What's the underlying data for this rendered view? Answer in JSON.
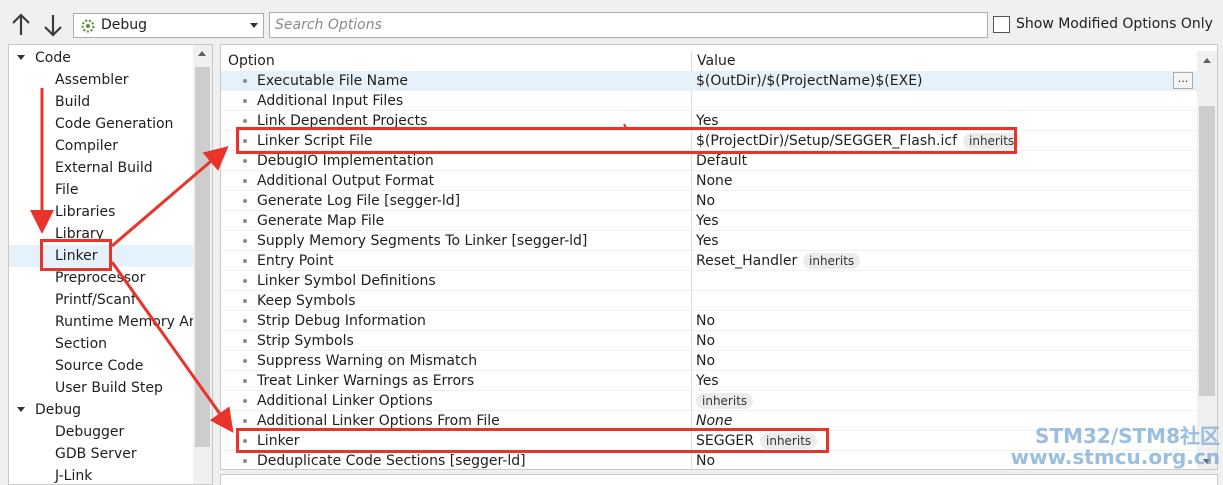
{
  "toolbar": {
    "config": "Debug",
    "search_placeholder": "Search Options",
    "show_modified_label": "Show Modified Options Only"
  },
  "tree": {
    "items": [
      {
        "label": "Code",
        "group": true
      },
      {
        "label": "Assembler"
      },
      {
        "label": "Build"
      },
      {
        "label": "Code Generation"
      },
      {
        "label": "Compiler"
      },
      {
        "label": "External Build"
      },
      {
        "label": "File"
      },
      {
        "label": "Libraries"
      },
      {
        "label": "Library"
      },
      {
        "label": "Linker",
        "selected": true
      },
      {
        "label": "Preprocessor"
      },
      {
        "label": "Printf/Scanf"
      },
      {
        "label": "Runtime Memory Ar"
      },
      {
        "label": "Section"
      },
      {
        "label": "Source Code"
      },
      {
        "label": "User Build Step"
      },
      {
        "label": "Debug",
        "group": true
      },
      {
        "label": "Debugger"
      },
      {
        "label": "GDB Server"
      },
      {
        "label": "J-Link"
      }
    ]
  },
  "grid": {
    "header_option": "Option",
    "header_value": "Value",
    "inherits_label": "inherits",
    "ellipsis": "...",
    "rows": [
      {
        "name": "Executable File Name",
        "value": "$(OutDir)/$(ProjectName)$(EXE)",
        "selected": true,
        "ellipsis": true
      },
      {
        "name": "Additional Input Files",
        "value": ""
      },
      {
        "name": "Link Dependent Projects",
        "value": "Yes"
      },
      {
        "name": "Linker Script File",
        "value": "$(ProjectDir)/Setup/SEGGER_Flash.icf",
        "inherits": true
      },
      {
        "name": "DebugIO Implementation",
        "value": "Default"
      },
      {
        "name": "Additional Output Format",
        "value": "None"
      },
      {
        "name": "Generate Log File [segger-ld]",
        "value": "No"
      },
      {
        "name": "Generate Map File",
        "value": "Yes"
      },
      {
        "name": "Supply Memory Segments To Linker [segger-ld]",
        "value": "Yes"
      },
      {
        "name": "Entry Point",
        "value": "Reset_Handler",
        "inherits": true
      },
      {
        "name": "Linker Symbol Definitions",
        "value": ""
      },
      {
        "name": "Keep Symbols",
        "value": ""
      },
      {
        "name": "Strip Debug Information",
        "value": "No"
      },
      {
        "name": "Strip Symbols",
        "value": "No"
      },
      {
        "name": "Suppress Warning on Mismatch",
        "value": "No"
      },
      {
        "name": "Treat Linker Warnings as Errors",
        "value": "Yes"
      },
      {
        "name": "Additional Linker Options",
        "value": "",
        "inherits": true
      },
      {
        "name": "Additional Linker Options From File",
        "value": "None",
        "italic": true
      },
      {
        "name": "Linker",
        "value": "SEGGER",
        "inherits": true
      },
      {
        "name": "Deduplicate Code Sections [segger-ld]",
        "value": "No"
      }
    ]
  },
  "annotation_color": "#e8342b",
  "watermark": {
    "line1": "STM32/STM8社区",
    "line2": "www.stmcu.org.cn"
  }
}
